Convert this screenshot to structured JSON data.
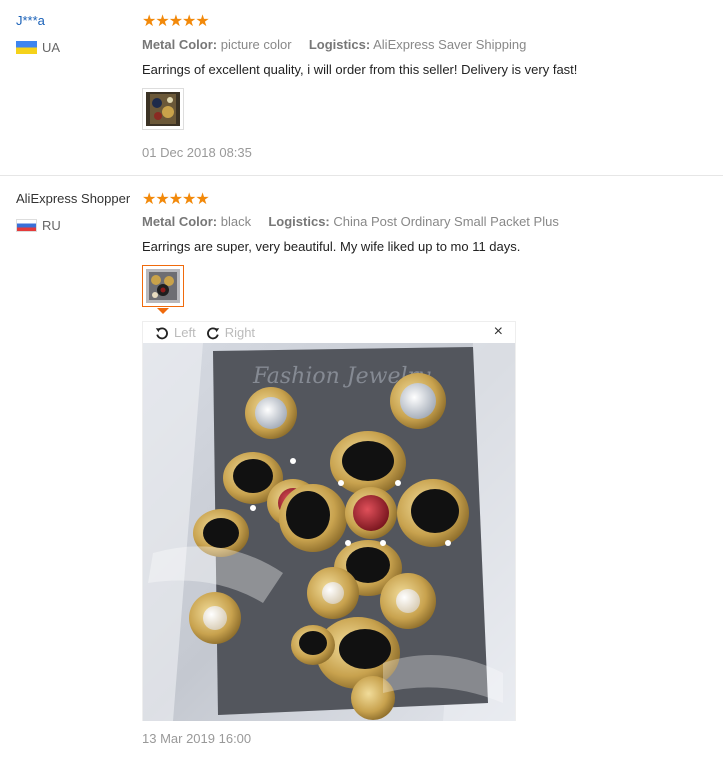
{
  "reviews": [
    {
      "user": "J***a",
      "country": "UA",
      "stars": "★★★★★",
      "metal_color_label": "Metal Color:",
      "metal_color": "picture color",
      "logistics_label": "Logistics:",
      "logistics": "AliExpress Saver Shipping",
      "text": "Earrings of excellent quality, i will order from this seller! Delivery is very fast!",
      "date": "01 Dec 2018 08:35"
    },
    {
      "user": "AliExpress Shopper",
      "country": "RU",
      "stars": "★★★★★",
      "metal_color_label": "Metal Color:",
      "metal_color": "black",
      "logistics_label": "Logistics:",
      "logistics": "China Post Ordinary Small Packet Plus",
      "text": "Earrings are super, very beautiful. My wife liked up to mo 11 days.",
      "date": "13 Mar 2019 16:00"
    }
  ],
  "viewer": {
    "rotate_left_label": "Left",
    "rotate_right_label": "Right",
    "close_symbol": "×"
  },
  "colors": {
    "star": "#f2890a",
    "username_link": "#1a61b8",
    "active_thumb_border": "#f06a0c"
  },
  "icons": {
    "rotate_left": "rotate-left-icon",
    "rotate_right": "rotate-right-icon",
    "close": "close-icon"
  }
}
